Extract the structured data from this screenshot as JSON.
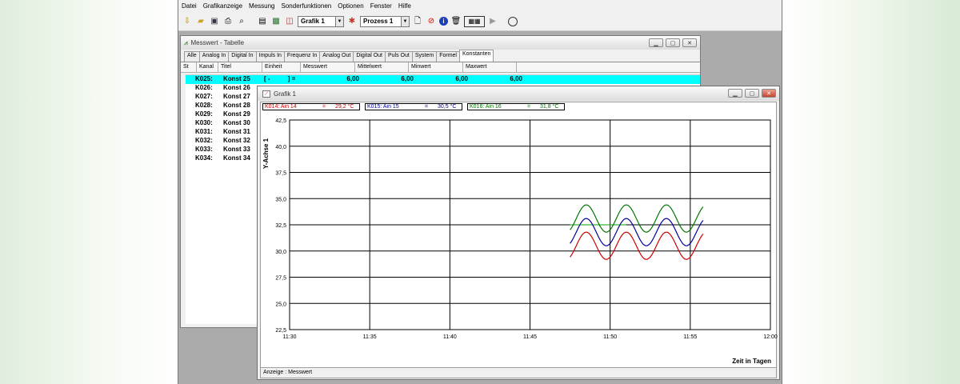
{
  "menu": [
    "Datei",
    "Grafikanzeige",
    "Messung",
    "Sonderfunktionen",
    "Optionen",
    "Fenster",
    "Hilfe"
  ],
  "toolbar": {
    "icons": [
      "connect-icon",
      "open-folder-icon",
      "save-icon",
      "print-icon",
      "zoom-icon",
      "table-icon",
      "image-icon",
      "chart-icon"
    ],
    "grafik_select": "Grafik 1",
    "prozess_select": "Prozess 1"
  },
  "messwert_window": {
    "title": "Messwert - Tabelle",
    "tabs": [
      "Alle",
      "Analog In",
      "Digital In",
      "Impuls In",
      "Frequenz In",
      "Analog Out",
      "Digital Out",
      "Puls Out",
      "System",
      "Formel",
      "Konstanten"
    ],
    "active_tab": "Konstanten",
    "columns": [
      "St",
      "Kanal",
      "Titel",
      "Einheit",
      "Messwert",
      "Mittelwert",
      "Minwert",
      "Maxwert"
    ],
    "selected_row": {
      "kanal": "K025:",
      "titel": "Konst 25",
      "einheit": "[ -          ] =",
      "messwert": "6,00",
      "mittelwert": "6,00",
      "minwert": "6,00",
      "maxwert": "6,00"
    },
    "rows": [
      {
        "kanal": "K026:",
        "titel": "Konst 26"
      },
      {
        "kanal": "K027:",
        "titel": "Konst 27"
      },
      {
        "kanal": "K028:",
        "titel": "Konst 28"
      },
      {
        "kanal": "K029:",
        "titel": "Konst 29"
      },
      {
        "kanal": "K030:",
        "titel": "Konst 30"
      },
      {
        "kanal": "K031:",
        "titel": "Konst 31"
      },
      {
        "kanal": "K032:",
        "titel": "Konst 32"
      },
      {
        "kanal": "K033:",
        "titel": "Konst 33"
      },
      {
        "kanal": "K034:",
        "titel": "Konst 34"
      }
    ]
  },
  "grafik_window": {
    "title": "Grafik 1",
    "legends": [
      {
        "label": "K014: Ain 14",
        "eq": "=",
        "value": "29,2 °C",
        "color": "#cc0000"
      },
      {
        "label": "K015: Ain 15",
        "eq": "=",
        "value": "30,5 °C",
        "color": "#000099"
      },
      {
        "label": "K016: Ain 16",
        "eq": "=",
        "value": "31,8 °C",
        "color": "#007700"
      }
    ],
    "status": "Anzeige : Messwert"
  },
  "chart_data": {
    "type": "line",
    "ylabel": "Y-Achse 1",
    "xlabel": "Zeit in Tagen",
    "yticks": [
      "22,5",
      "25,0",
      "27,5",
      "30,0",
      "32,5",
      "35,0",
      "37,5",
      "40,0",
      "42,5"
    ],
    "ylim": [
      22.5,
      42.5
    ],
    "xticks": [
      "11:30",
      "11:35",
      "11:40",
      "11:45",
      "11:50",
      "11:55",
      "12:00"
    ],
    "xlim_minutes": [
      0,
      30
    ],
    "grid": true,
    "series": [
      {
        "name": "K014: Ain 14",
        "color": "#cc0000",
        "x_start": 17.5,
        "x_end": 25.8,
        "center": 30.5,
        "amplitude": 1.3,
        "period": 2.5
      },
      {
        "name": "K015: Ain 15",
        "color": "#000099",
        "x_start": 17.5,
        "x_end": 25.8,
        "center": 31.8,
        "amplitude": 1.3,
        "period": 2.5
      },
      {
        "name": "K016: Ain 16",
        "color": "#007700",
        "x_start": 17.5,
        "x_end": 25.8,
        "center": 33.1,
        "amplitude": 1.3,
        "period": 2.5
      }
    ],
    "reference_line": {
      "y": 32.5,
      "x_start": 17.5,
      "x_end": 21.0,
      "color": "#00aa00"
    }
  }
}
